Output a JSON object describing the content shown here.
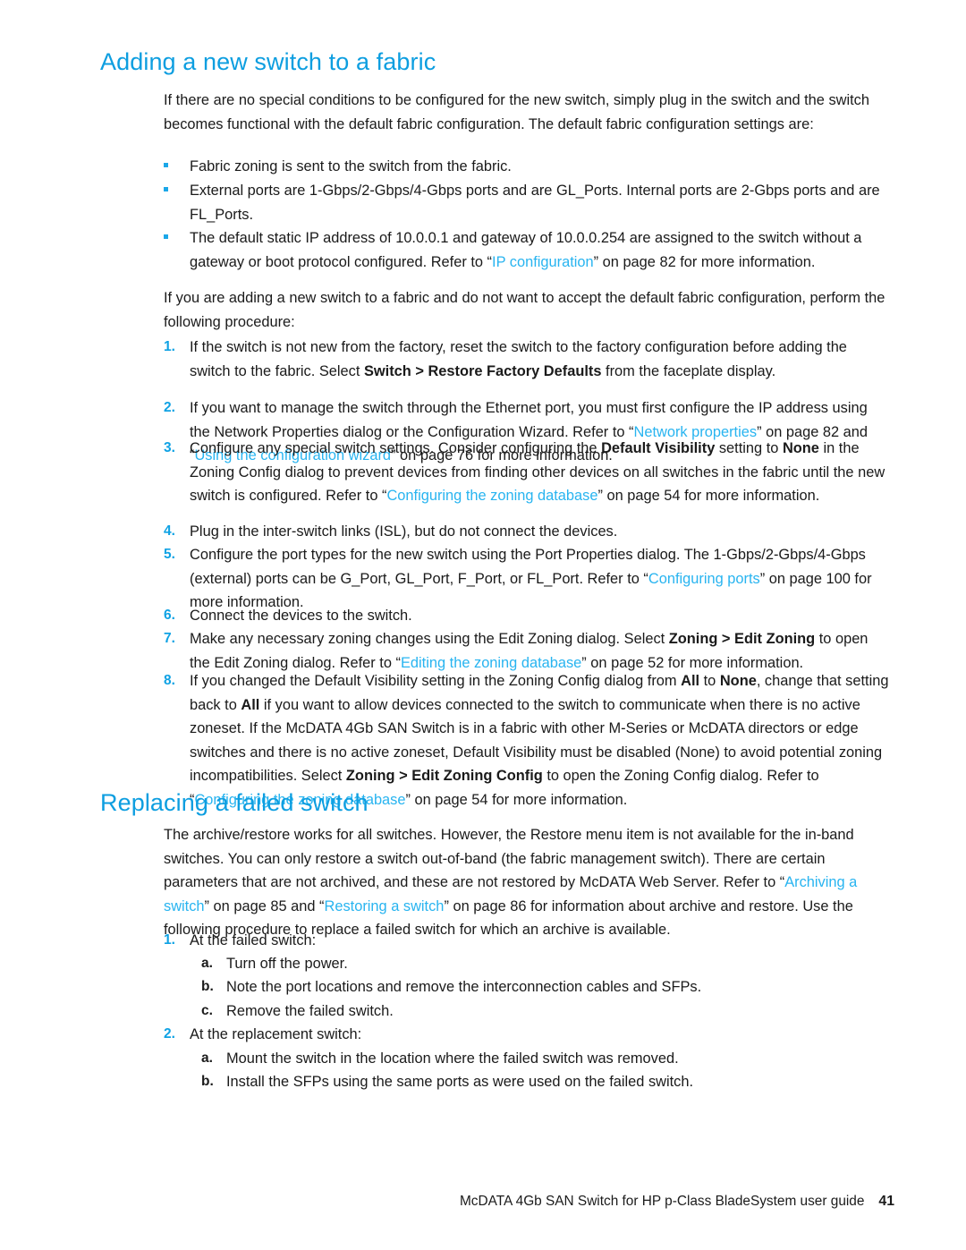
{
  "document": {
    "title": "McDATA 4Gb SAN Switch for HP p-Class BladeSystem user guide",
    "page_number": "41"
  },
  "colors": {
    "heading_blue": "#0d9ee0",
    "link_blue": "#28b4f0",
    "number_blue": "#0fa2e4",
    "bullet_blue": "#1ba7e8",
    "body_text": "#1b1b1b",
    "page_background": "#ffffff"
  },
  "sections": [
    {
      "heading": "Adding a new switch to a fabric",
      "intro": "If there are no special conditions to be configured for the new switch, simply plug in the switch and the switch becomes functional with the default fabric configuration. The default fabric configuration settings are:",
      "bullets": [
        {
          "runs": [
            {
              "text": "Fabric zoning is sent to the switch from the fabric."
            }
          ]
        },
        {
          "runs": [
            {
              "text": "External ports are 1-Gbps/2-Gbps/4-Gbps ports and are GL_Ports. Internal ports are 2-Gbps ports and are FL_Ports."
            }
          ]
        },
        {
          "runs": [
            {
              "text": "The default static IP address of 10.0.0.1 and gateway of 10.0.0.254 are assigned to the switch without a gateway or boot protocol configured. Refer to “"
            },
            {
              "text": "IP configuration",
              "style": "link"
            },
            {
              "text": "” on page 82 for more information."
            }
          ]
        }
      ],
      "procedure_intro": "If you are adding a new switch to a fabric and do not want to accept the default fabric configuration, perform the following procedure:",
      "steps": [
        {
          "marker": "1.",
          "runs": [
            {
              "text": "If the switch is not new from the factory, reset the switch to the factory configuration before adding the switch to the fabric. Select "
            },
            {
              "text": "Switch > Restore Factory Defaults",
              "style": "bold"
            },
            {
              "text": " from the faceplate display."
            }
          ]
        },
        {
          "marker": "2.",
          "runs": [
            {
              "text": "If you want to manage the switch through the Ethernet port, you must first configure the IP address using the Network Properties dialog or the Configuration Wizard. Refer to “"
            },
            {
              "text": "Network properties",
              "style": "link"
            },
            {
              "text": "” on page 82 and “"
            },
            {
              "text": "Using the configuration wizard",
              "style": "link"
            },
            {
              "text": "” on page 76 for more information."
            }
          ]
        },
        {
          "marker": "3.",
          "runs": [
            {
              "text": "Configure any special switch settings. Consider configuring the "
            },
            {
              "text": "Default Visibility",
              "style": "bold"
            },
            {
              "text": " setting to "
            },
            {
              "text": "None",
              "style": "bold"
            },
            {
              "text": " in the Zoning Config dialog to prevent devices from finding other devices on all switches in the fabric until the new switch is configured. Refer to “"
            },
            {
              "text": "Configuring the zoning database",
              "style": "link"
            },
            {
              "text": "” on page 54 for more information."
            }
          ]
        },
        {
          "marker": "4.",
          "runs": [
            {
              "text": "Plug in the inter-switch links (ISL), but do not connect the devices."
            }
          ]
        },
        {
          "marker": "5.",
          "runs": [
            {
              "text": "Configure the port types for the new switch using the Port Properties dialog. The 1-Gbps/2-Gbps/4-Gbps (external) ports can be G_Port, GL_Port, F_Port, or FL_Port. Refer to “"
            },
            {
              "text": "Configuring ports",
              "style": "link"
            },
            {
              "text": "” on page 100 for more information."
            }
          ]
        },
        {
          "marker": "6.",
          "runs": [
            {
              "text": "Connect the devices to the switch."
            }
          ]
        },
        {
          "marker": "7.",
          "runs": [
            {
              "text": "Make any necessary zoning changes using the Edit Zoning dialog. Select "
            },
            {
              "text": "Zoning > Edit Zoning",
              "style": "bold"
            },
            {
              "text": " to open the Edit Zoning dialog. Refer to “"
            },
            {
              "text": "Editing the zoning database",
              "style": "link"
            },
            {
              "text": "” on page 52 for more information."
            }
          ]
        },
        {
          "marker": "8.",
          "runs": [
            {
              "text": "If you changed the Default Visibility setting in the Zoning Config dialog from "
            },
            {
              "text": "All",
              "style": "bold"
            },
            {
              "text": " to "
            },
            {
              "text": "None",
              "style": "bold"
            },
            {
              "text": ", change that setting back to "
            },
            {
              "text": "All",
              "style": "bold"
            },
            {
              "text": " if you want to allow devices connected to the switch to communicate when there is no active zoneset. If the McDATA 4Gb SAN Switch is in a fabric with other M-Series or McDATA directors or edge switches and there is no active zoneset, Default Visibility must be disabled (None) to avoid potential zoning incompatibilities. Select "
            },
            {
              "text": "Zoning > Edit Zoning Config",
              "style": "bold"
            },
            {
              "text": " to open the Zoning Config dialog. Refer to “"
            },
            {
              "text": "Configuring the zoning database",
              "style": "link"
            },
            {
              "text": "” on page 54 for more information."
            }
          ]
        }
      ]
    },
    {
      "heading": "Replacing a failed switch",
      "intro_runs": [
        {
          "text": "The archive/restore works for all switches. However, the Restore menu item is not available for the in-band switches. You can only restore a switch out-of-band (the fabric management switch). There are certain parameters that are not archived, and these are not restored by McDATA Web Server. Refer to “"
        },
        {
          "text": "Archiving a switch",
          "style": "link"
        },
        {
          "text": "” on page 85 and “"
        },
        {
          "text": "Restoring a switch",
          "style": "link"
        },
        {
          "text": "” on page 86 for information about archive and restore. Use the following procedure to replace a failed switch for which an archive is available."
        }
      ],
      "steps": [
        {
          "marker": "1.",
          "runs": [
            {
              "text": "At the failed switch:"
            }
          ],
          "substeps": [
            {
              "marker": "a.",
              "text": "Turn off the power."
            },
            {
              "marker": "b.",
              "text": "Note the port locations and remove the interconnection cables and SFPs."
            },
            {
              "marker": "c.",
              "text": "Remove the failed switch."
            }
          ]
        },
        {
          "marker": "2.",
          "runs": [
            {
              "text": "At the replacement switch:"
            }
          ],
          "substeps": [
            {
              "marker": "a.",
              "text": "Mount the switch in the location where the failed switch was removed."
            },
            {
              "marker": "b.",
              "text": "Install the SFPs using the same ports as were used on the failed switch."
            }
          ]
        }
      ]
    }
  ]
}
